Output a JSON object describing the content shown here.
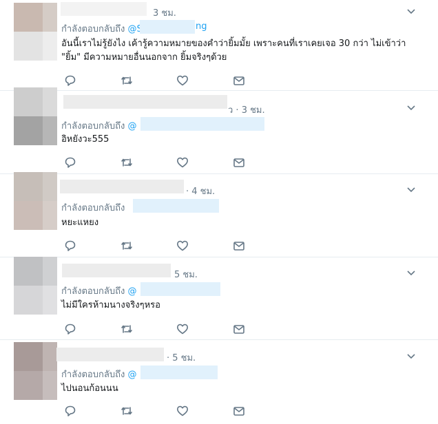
{
  "tweets": [
    {
      "time": "3 ชม.",
      "reply_prefix": "กำลังตอบกลับถึง",
      "mention_start": "@S",
      "mention_end": "ng",
      "text_line1": "อันนี้เราไม่รู้ยังไง เค้ารู้ความหมายของคำว่ายิ้มมั้ย เพราะคนที่เราเคยเจอ 30 กว่า ไม่เข้าว่า",
      "text_line2": "\"ยิ้ม\" มีความหมายอื่นนอกจาก ยิ้มจริงๆด้วย"
    },
    {
      "time": "ว · 3 ชม.",
      "reply_prefix": "กำลังตอบกลับถึง",
      "mention_start": "@",
      "text_line1": "อิหยังวะ555"
    },
    {
      "time": "· 4 ชม.",
      "reply_prefix": "กำลังตอบกลับถึง",
      "text_line1": "หยะแหยง"
    },
    {
      "time": "5 ชม.",
      "reply_prefix": "กำลังตอบกลับถึง",
      "mention_start": "@",
      "text_line1": "ไม่มีใครห้ามนางจริงๆหรอ"
    },
    {
      "time": "· 5 ชม.",
      "reply_prefix": "กำลังตอบกลับถึง",
      "mention_start": "@",
      "text_line1": "ไปนอนก้อนนน"
    }
  ],
  "icons": [
    "reply-icon",
    "retweet-icon",
    "like-icon",
    "dm-icon",
    "chevron-down-icon"
  ],
  "colors": {
    "accent": "#1da1f2",
    "muted": "#657786",
    "text": "#14171a",
    "divider": "#e6ecf0"
  }
}
